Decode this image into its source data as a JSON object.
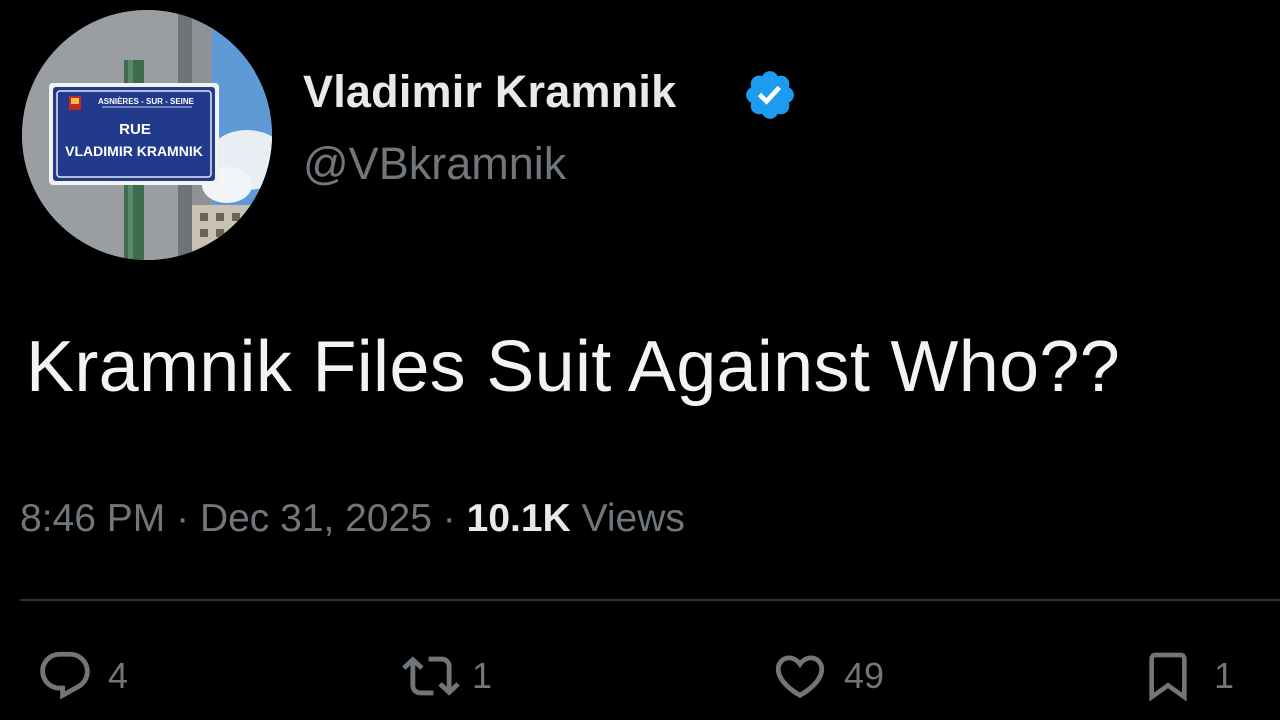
{
  "author": {
    "display_name": "Vladimir Kramnik",
    "handle": "@VBkramnik",
    "verified_icon": "verified-badge-icon",
    "avatar_sign": {
      "top_line": "ASNIÈRES - SUR - SEINE",
      "line1": "RUE",
      "line2": "VLADIMIR KRAMNIK"
    }
  },
  "tweet": {
    "text": "Kramnik Files Suit Against Who??",
    "time": "8:46 PM",
    "separator": "·",
    "date": "Dec 31, 2025",
    "views_count": "10.1K",
    "views_label": "Views"
  },
  "actions": {
    "reply": {
      "icon": "reply-icon",
      "count": "4"
    },
    "retweet": {
      "icon": "retweet-icon",
      "count": "1"
    },
    "like": {
      "icon": "heart-icon",
      "count": "49"
    },
    "bookmark": {
      "icon": "bookmark-icon",
      "count": "1"
    }
  },
  "colors": {
    "background": "#000000",
    "primary_text": "#e7e9ea",
    "secondary_text": "#71767b",
    "verified_blue": "#1d9bf0",
    "divider": "#2f3336"
  }
}
